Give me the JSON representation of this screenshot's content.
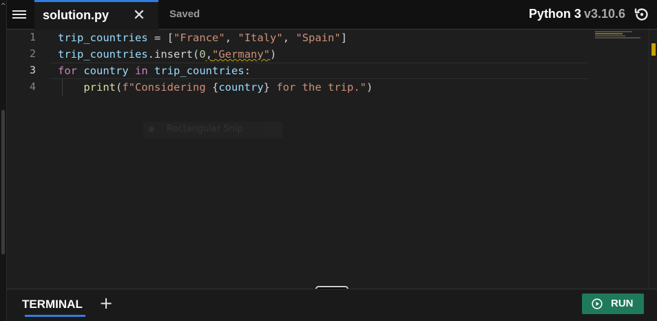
{
  "header": {
    "file_tab": "solution.py",
    "close_glyph": "✕",
    "save_status": "Saved",
    "language_name": "Python 3",
    "language_version": "v3.10.6",
    "menu_icon": "hamburger-menu-icon",
    "history_icon": "history-icon"
  },
  "editor": {
    "line_numbers": [
      "1",
      "2",
      "3",
      "4"
    ],
    "active_line": "3",
    "ghost_text": "Rectangular Snip"
  },
  "terminal": {
    "tab_label": "TERMINAL",
    "add_glyph": "+",
    "run_label": "RUN"
  },
  "colors": {
    "accent": "#2f7fe0",
    "run_button": "#1e7a5a",
    "string": "#ce9178",
    "keyword": "#c586c0",
    "function": "#dcdcaa",
    "variable": "#9cdcfe"
  }
}
